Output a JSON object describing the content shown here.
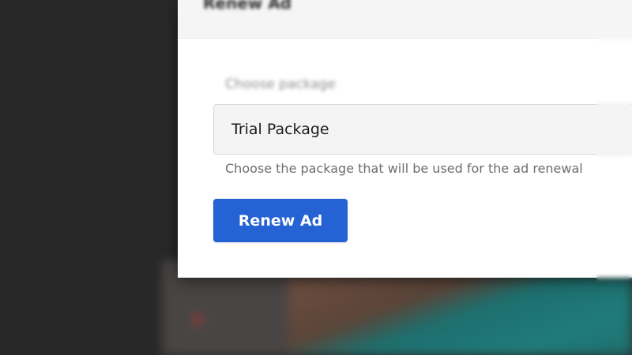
{
  "modal": {
    "title": "Renew Ad",
    "field": {
      "label": "Choose package",
      "selected_value": "Trial Package",
      "help_text": "Choose the package that will be used for the ad renewal"
    },
    "submit_label": "Renew Ad"
  },
  "colors": {
    "primary_button": "#2563d4",
    "overlay": "#2b2b2b"
  }
}
